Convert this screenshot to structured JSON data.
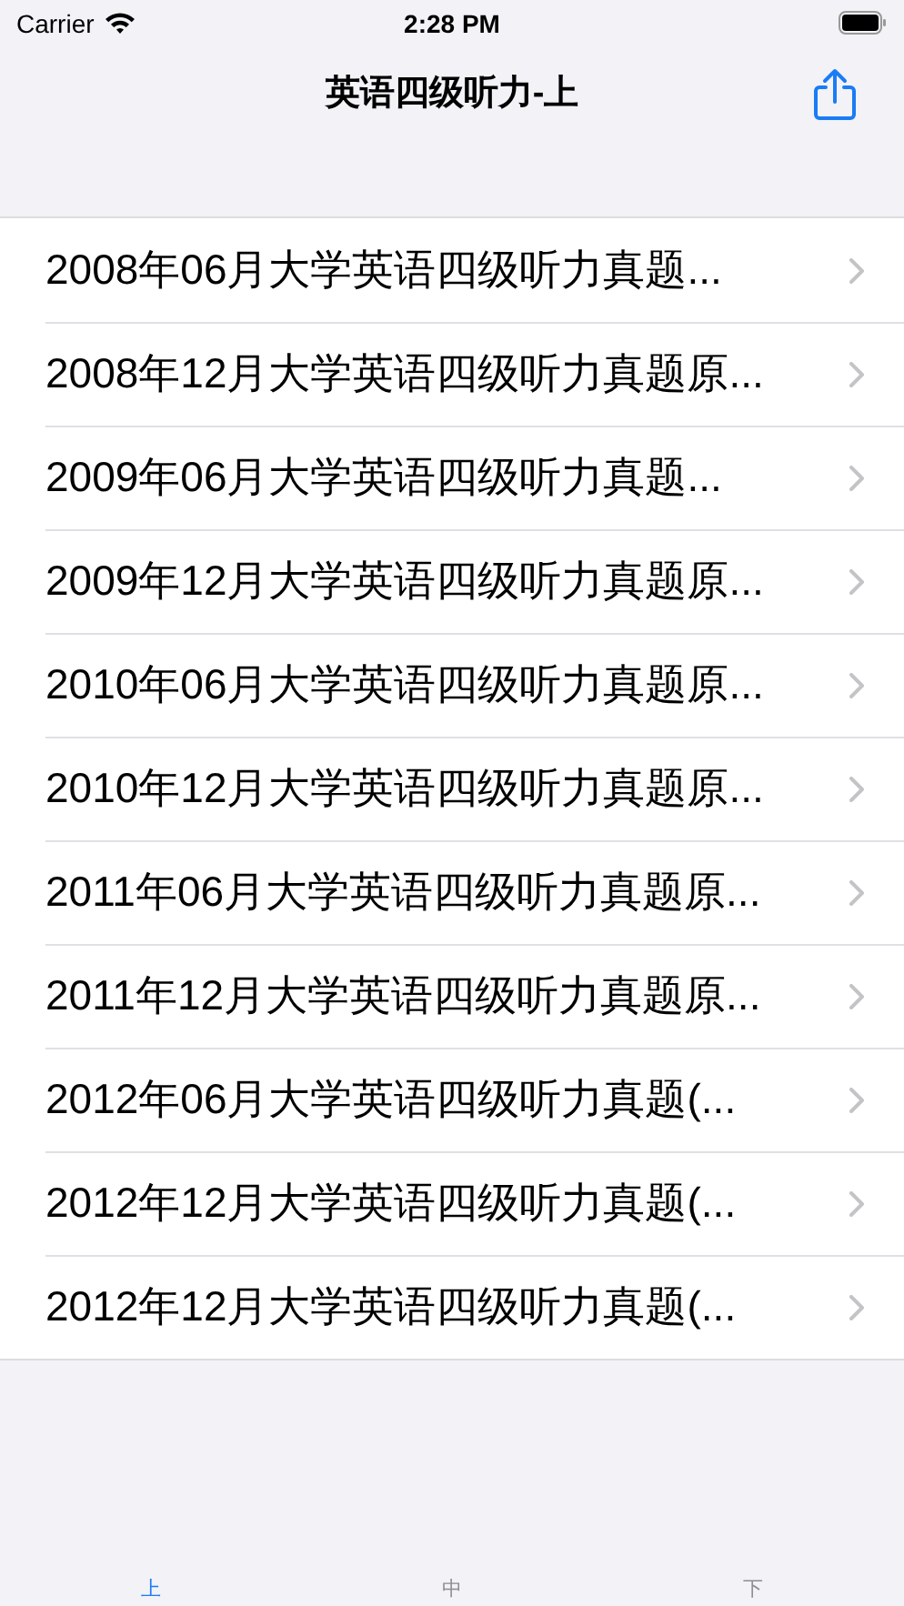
{
  "status_bar": {
    "carrier": "Carrier",
    "time": "2:28 PM"
  },
  "nav_bar": {
    "title": "英语四级听力-上"
  },
  "list": [
    {
      "title": "2008年06月大学英语四级听力真题..."
    },
    {
      "title": "2008年12月大学英语四级听力真题原..."
    },
    {
      "title": "2009年06月大学英语四级听力真题..."
    },
    {
      "title": "2009年12月大学英语四级听力真题原..."
    },
    {
      "title": "2010年06月大学英语四级听力真题原..."
    },
    {
      "title": "2010年12月大学英语四级听力真题原..."
    },
    {
      "title": "2011年06月大学英语四级听力真题原..."
    },
    {
      "title": "2011年12月大学英语四级听力真题原..."
    },
    {
      "title": "2012年06月大学英语四级听力真题(..."
    },
    {
      "title": "2012年12月大学英语四级听力真题(..."
    },
    {
      "title": "2012年12月大学英语四级听力真题(..."
    }
  ],
  "tab_bar": [
    {
      "label": "上",
      "selected": true
    },
    {
      "label": "中",
      "selected": false
    },
    {
      "label": "下",
      "selected": false
    }
  ]
}
